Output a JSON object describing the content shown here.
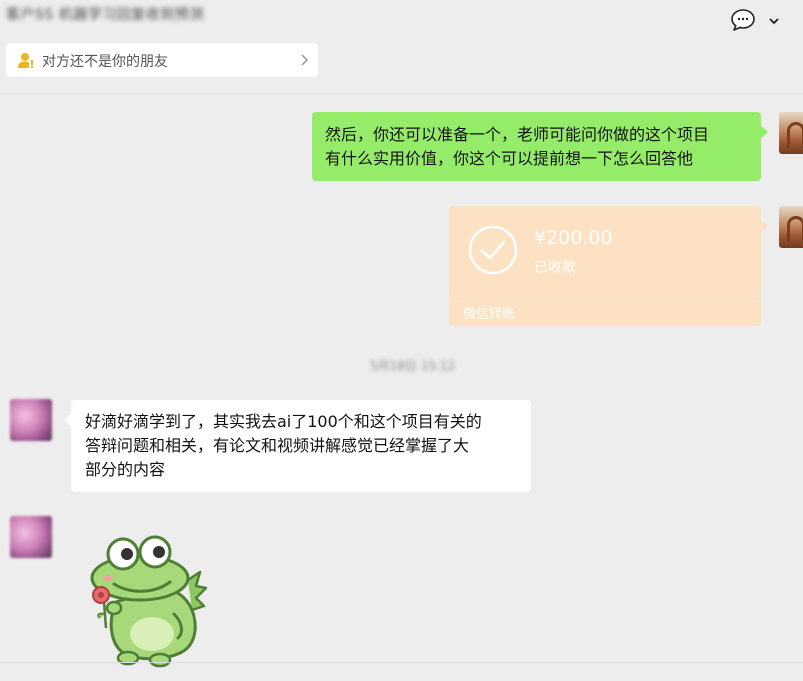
{
  "header": {
    "title": "客户SS 机器学习回复收到预测"
  },
  "notice": {
    "text": "对方还不是你的朋友"
  },
  "messages": {
    "outgoing_text": {
      "line1": "然后，你还可以准备一个，老师可能问你做的这个项目",
      "line2": "有什么实用价值，你这个可以提前想一下怎么回答他"
    },
    "transfer": {
      "amount": "¥200.00",
      "status": "已收款",
      "source": "微信转账"
    },
    "timestamp": "5月18日 15:12",
    "incoming_text": {
      "line1": "好滴好滴学到了，其实我去ai了100个和这个项目有关的",
      "line2": "答辩问题和相关，有论文和视频讲解感觉已经掌握了大",
      "line3": "部分的内容"
    }
  },
  "colors": {
    "background": "#ededed",
    "outgoing_bubble": "#95ec69",
    "transfer_card": "#fce1c3",
    "incoming_bubble": "#ffffff",
    "warning_icon": "#f0b323"
  },
  "icons": {
    "notice_icon": "user-warning-icon",
    "notice_chevron": "chevron-right-icon",
    "menu_icon": "chat-bubble-icon",
    "menu_chevron": "chevron-down-icon",
    "transfer_icon": "check-circle-icon"
  }
}
